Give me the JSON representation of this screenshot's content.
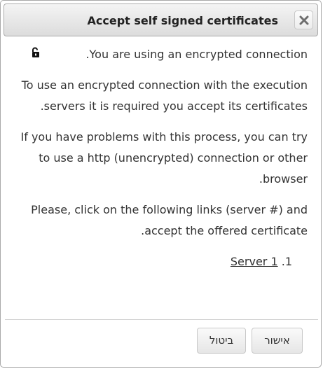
{
  "dialog": {
    "title": "Accept self signed certificates",
    "close_icon": "close-icon",
    "lock_icon": "lock-icon",
    "paragraphs": {
      "p1": "You are using an encrypted connection.",
      "p2": "To use an encrypted connection with the execution servers it is required you accept its certificates.",
      "p3": "If you have problems with this process, you can try to use a http (unencrypted) connection or other browser.",
      "p4": "Please, click on the following links (server #) and accept the offered certificate."
    },
    "servers": [
      {
        "number": "1.",
        "label": "Server 1"
      }
    ],
    "buttons": {
      "ok_label": "אישור",
      "cancel_label": "ביטול"
    }
  }
}
